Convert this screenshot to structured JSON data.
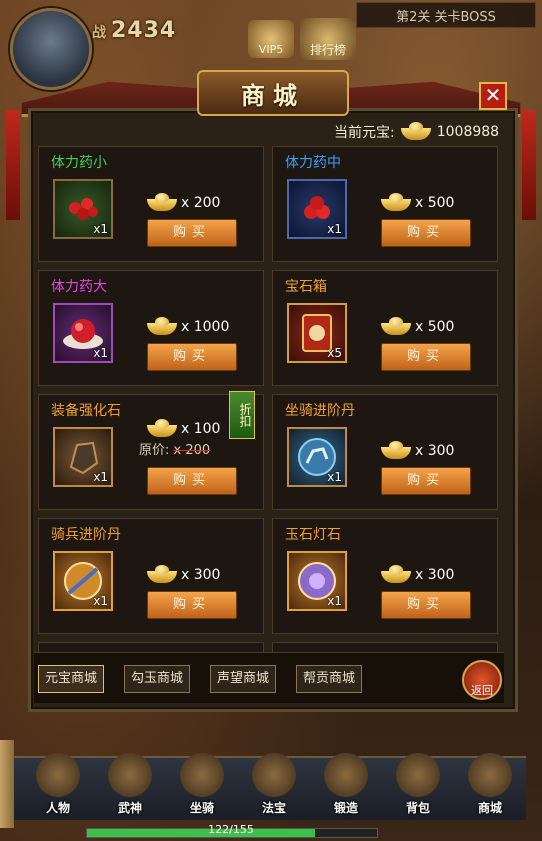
{
  "hud": {
    "power_label": "战",
    "power": "2434",
    "vip": "VIP5",
    "rank": "排行榜",
    "stage": "第2关 关卡BOSS"
  },
  "shop": {
    "title": "商城",
    "currency_label": "当前元宝:",
    "currency_value": "1008988",
    "items": [
      {
        "name": "体力药小",
        "color": "#3fd44a",
        "qty": "x1",
        "price": "x 200",
        "buy": "购买"
      },
      {
        "name": "体力药中",
        "color": "#3aa0ff",
        "qty": "x1",
        "price": "x 500",
        "buy": "购买"
      },
      {
        "name": "体力药大",
        "color": "#e04adf",
        "qty": "x1",
        "price": "x 1000",
        "buy": "购买"
      },
      {
        "name": "宝石箱",
        "color": "#f0a030",
        "qty": "x5",
        "price": "x 500",
        "buy": "购买"
      },
      {
        "name": "装备强化石",
        "color": "#f0a030",
        "qty": "x1",
        "price": "x 100",
        "buy": "购买",
        "orig_label": "原价:",
        "orig_price": "x 200",
        "badge": "折扣"
      },
      {
        "name": "坐骑进阶丹",
        "color": "#f0a030",
        "qty": "x1",
        "price": "x 300",
        "buy": "购买"
      },
      {
        "name": "骑兵进阶丹",
        "color": "#f0a030",
        "qty": "x1",
        "price": "x 300",
        "buy": "购买"
      },
      {
        "name": "玉石灯石",
        "color": "#f0a030",
        "qty": "x1",
        "price": "x 300",
        "buy": "购买"
      }
    ],
    "tabs": [
      "元宝商城",
      "勾玉商城",
      "声望商城",
      "帮贡商城"
    ],
    "back": "返回"
  },
  "menu": [
    "人物",
    "武神",
    "坐骑",
    "法宝",
    "锻造",
    "背包",
    "商城"
  ],
  "exp": {
    "text": "122/155",
    "fraction": 0.787
  }
}
